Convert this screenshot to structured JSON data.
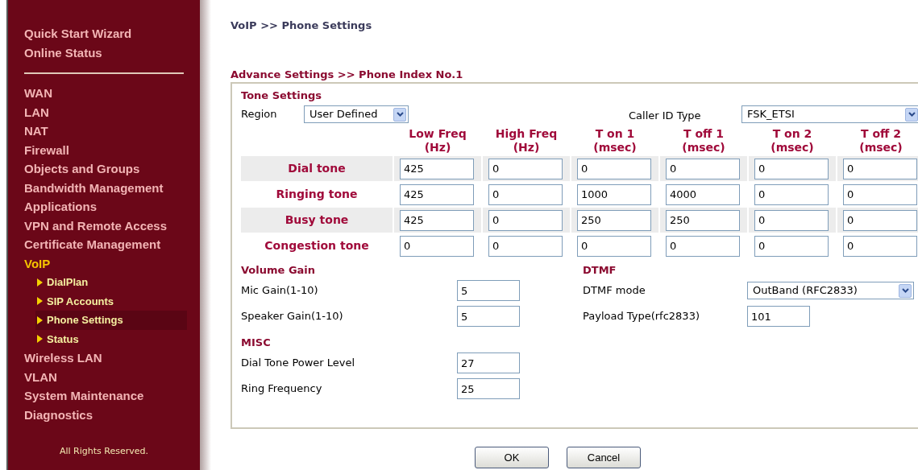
{
  "sidebar": {
    "top_items": [
      "Quick Start Wizard",
      "Online Status"
    ],
    "items": [
      {
        "label": "WAN",
        "selected": false
      },
      {
        "label": "LAN",
        "selected": false
      },
      {
        "label": "NAT",
        "selected": false
      },
      {
        "label": "Firewall",
        "selected": false
      },
      {
        "label": "Objects and Groups",
        "selected": false
      },
      {
        "label": "Bandwidth Management",
        "selected": false
      },
      {
        "label": "Applications",
        "selected": false
      },
      {
        "label": "VPN and Remote Access",
        "selected": false
      },
      {
        "label": "Certificate Management",
        "selected": false
      },
      {
        "label": "VoIP",
        "selected": true,
        "children": [
          {
            "label": "DialPlan",
            "selected": false
          },
          {
            "label": "SIP Accounts",
            "selected": false
          },
          {
            "label": "Phone Settings",
            "selected": true
          },
          {
            "label": "Status",
            "selected": false
          }
        ]
      },
      {
        "label": "Wireless LAN",
        "selected": false
      },
      {
        "label": "VLAN",
        "selected": false
      },
      {
        "label": "System Maintenance",
        "selected": false
      },
      {
        "label": "Diagnostics",
        "selected": false
      }
    ],
    "footer": "All Rights Reserved."
  },
  "page_title": "VoIP >> Phone Settings",
  "section_title": "Advance Settings >> Phone Index No.1",
  "tone_settings": {
    "title": "Tone Settings",
    "region": {
      "label": "Region",
      "value": "User Defined"
    },
    "caller_id": {
      "label": "Caller ID Type",
      "value": "FSK_ETSI"
    },
    "columns": [
      [
        "Low Freq",
        "(Hz)"
      ],
      [
        "High Freq",
        "(Hz)"
      ],
      [
        "T on 1",
        "(msec)"
      ],
      [
        "T off 1",
        "(msec)"
      ],
      [
        "T on 2",
        "(msec)"
      ],
      [
        "T off 2",
        "(msec)"
      ]
    ],
    "rows": [
      {
        "label": "Dial tone",
        "values": [
          "425",
          "0",
          "0",
          "0",
          "0",
          "0"
        ]
      },
      {
        "label": "Ringing tone",
        "values": [
          "425",
          "0",
          "1000",
          "4000",
          "0",
          "0"
        ]
      },
      {
        "label": "Busy tone",
        "values": [
          "425",
          "0",
          "250",
          "250",
          "0",
          "0"
        ]
      },
      {
        "label": "Congestion tone",
        "values": [
          "0",
          "0",
          "0",
          "0",
          "0",
          "0"
        ]
      }
    ]
  },
  "volume_gain": {
    "title": "Volume Gain",
    "fields": [
      {
        "label": "Mic Gain(1-10)",
        "value": "5"
      },
      {
        "label": "Speaker Gain(1-10)",
        "value": "5"
      }
    ]
  },
  "dtmf": {
    "title": "DTMF",
    "mode": {
      "label": "DTMF mode",
      "value": "OutBand (RFC2833)"
    },
    "payload": {
      "label": "Payload Type(rfc2833)",
      "value": "101"
    }
  },
  "misc": {
    "title": "MISC",
    "fields": [
      {
        "label": "Dial Tone Power Level",
        "value": "27"
      },
      {
        "label": "Ring Frequency",
        "value": "25"
      }
    ]
  },
  "buttons": [
    "OK",
    "Cancel"
  ]
}
